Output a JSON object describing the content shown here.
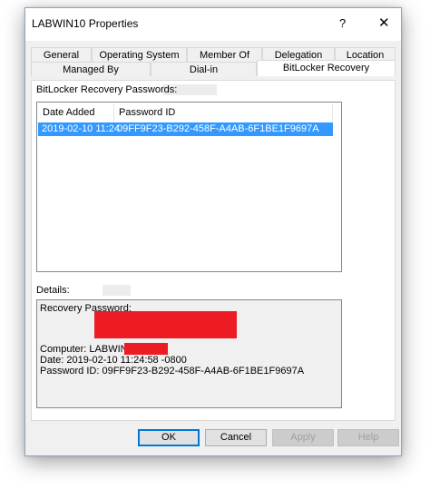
{
  "window": {
    "title": "LABWIN10 Properties",
    "help_glyph": "?",
    "close_glyph": "✕"
  },
  "tabs": {
    "row1": [
      "General",
      "Operating System",
      "Member Of",
      "Delegation",
      "Location"
    ],
    "row2": [
      "Managed By",
      "Dial-in",
      "BitLocker Recovery"
    ],
    "selected": "BitLocker Recovery"
  },
  "passwords": {
    "label": "BitLocker Recovery Passwords:",
    "columns": [
      "Date Added",
      "Password ID"
    ],
    "rows": [
      {
        "date": "2019-02-10 11:24",
        "id": "09FF9F23-B292-458F-A4AB-6F1BE1F9697A"
      }
    ]
  },
  "details": {
    "label": "Details:",
    "recovery_password_label": "Recovery Password:",
    "computer": "Computer: LABWIN10",
    "date": "Date: 2019-02-10 11:24:58 -0800",
    "password_id": "Password ID: 09FF9F23-B292-458F-A4AB-6F1BE1F9697A"
  },
  "buttons": {
    "ok": "OK",
    "cancel": "Cancel",
    "apply": "Apply",
    "help": "Help"
  },
  "colors": {
    "selection": "#3399ff",
    "redaction": "#ed1c24",
    "default_button_border": "#0078d7"
  }
}
